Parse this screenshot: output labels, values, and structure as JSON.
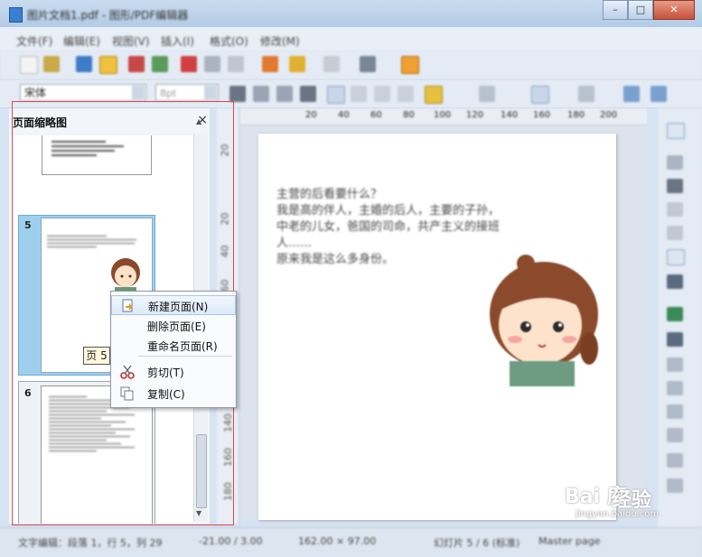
{
  "window": {
    "title": "图片文档1.pdf - 图形/PDF编辑器"
  },
  "menu": [
    "文件(F)",
    "编辑(E)",
    "视图(V)",
    "插入(I)",
    "格式(O)",
    "修改(M)"
  ],
  "toolbar": {
    "font_name": "宋体",
    "font_size": "8pt"
  },
  "panel": {
    "title": "页面缩略图",
    "close_glyph": "×",
    "thumbs": [
      {
        "number": "5",
        "lines": [
          "主营的后看要什么？",
          "我是这的伴人，主婚的后人，",
          "自重的子孙，",
          "中直的人丛，",
          "前面将来由您",
          "原来我是这么多身份。"
        ]
      },
      {
        "number": "6"
      }
    ]
  },
  "ruler": {
    "left_ticks": [
      "20",
      "20",
      "40",
      "60",
      "80",
      "100",
      "120",
      "140",
      "160",
      "180"
    ],
    "top_ticks": [
      "20",
      "40",
      "60",
      "80",
      "100",
      "120",
      "140",
      "160",
      "180",
      "200"
    ]
  },
  "document": {
    "lines": [
      "主营的后看要什么？",
      "我是高的伴人，主婚的后人，主要的子孙，",
      "中老的儿女，爸国的司命，共产主义的接班",
      "人……",
      "原来我是这么多身份。"
    ]
  },
  "context_menu": {
    "items": [
      {
        "label": "新建页面(N)",
        "icon": "new-page-icon",
        "highlighted": true
      },
      {
        "label": "删除页面(E)",
        "icon": "",
        "highlighted": false
      },
      {
        "label": "重命名页面(R)",
        "icon": "",
        "highlighted": false
      },
      {
        "label": "剪切(T)",
        "icon": "scissors-icon",
        "highlighted": false
      },
      {
        "label": "复制(C)",
        "icon": "copy-icon",
        "highlighted": false
      }
    ]
  },
  "tooltip": "页 5",
  "statusbar": {
    "items": [
      "文字编辑：段落 1，行 5，列 29",
      "-21.00 / 3.00",
      "162.00 × 97.00",
      "幻灯片 5 / 6 (标准)",
      "Master page"
    ]
  },
  "watermark": {
    "logo": "Bai 度",
    "text": "经验",
    "url": "jingyan.baidu.com"
  }
}
